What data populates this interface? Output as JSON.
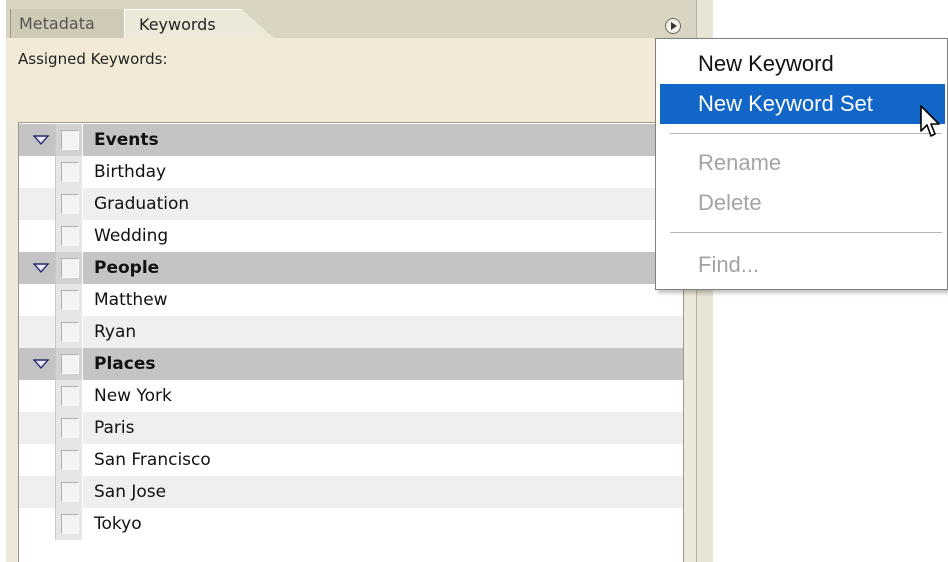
{
  "tabs": [
    {
      "label": "Metadata",
      "active": false
    },
    {
      "label": "Keywords",
      "active": true
    }
  ],
  "assigned_label": "Assigned Keywords:",
  "keyword_rows": [
    {
      "label": "Events",
      "group": true
    },
    {
      "label": "Birthday",
      "group": false
    },
    {
      "label": "Graduation",
      "group": false
    },
    {
      "label": "Wedding",
      "group": false
    },
    {
      "label": "People",
      "group": true
    },
    {
      "label": "Matthew",
      "group": false
    },
    {
      "label": "Ryan",
      "group": false
    },
    {
      "label": "Places",
      "group": true
    },
    {
      "label": "New York",
      "group": false
    },
    {
      "label": "Paris",
      "group": false
    },
    {
      "label": "San Francisco",
      "group": false
    },
    {
      "label": "San Jose",
      "group": false
    },
    {
      "label": "Tokyo",
      "group": false
    }
  ],
  "menu": {
    "new_keyword": "New Keyword",
    "new_keyword_set": "New Keyword Set",
    "rename": "Rename",
    "delete": "Delete",
    "find": "Find..."
  },
  "colors": {
    "panel_bg": "#ece9d8",
    "menu_highlight": "#1166c8",
    "disabled_text": "#a4a4a4",
    "group_row_bg": "#c4c4c4"
  },
  "icons": {
    "panel_menu": "flyout-arrow-icon",
    "expand": "expand-triangle-icon",
    "cursor": "mouse-pointer-icon"
  }
}
